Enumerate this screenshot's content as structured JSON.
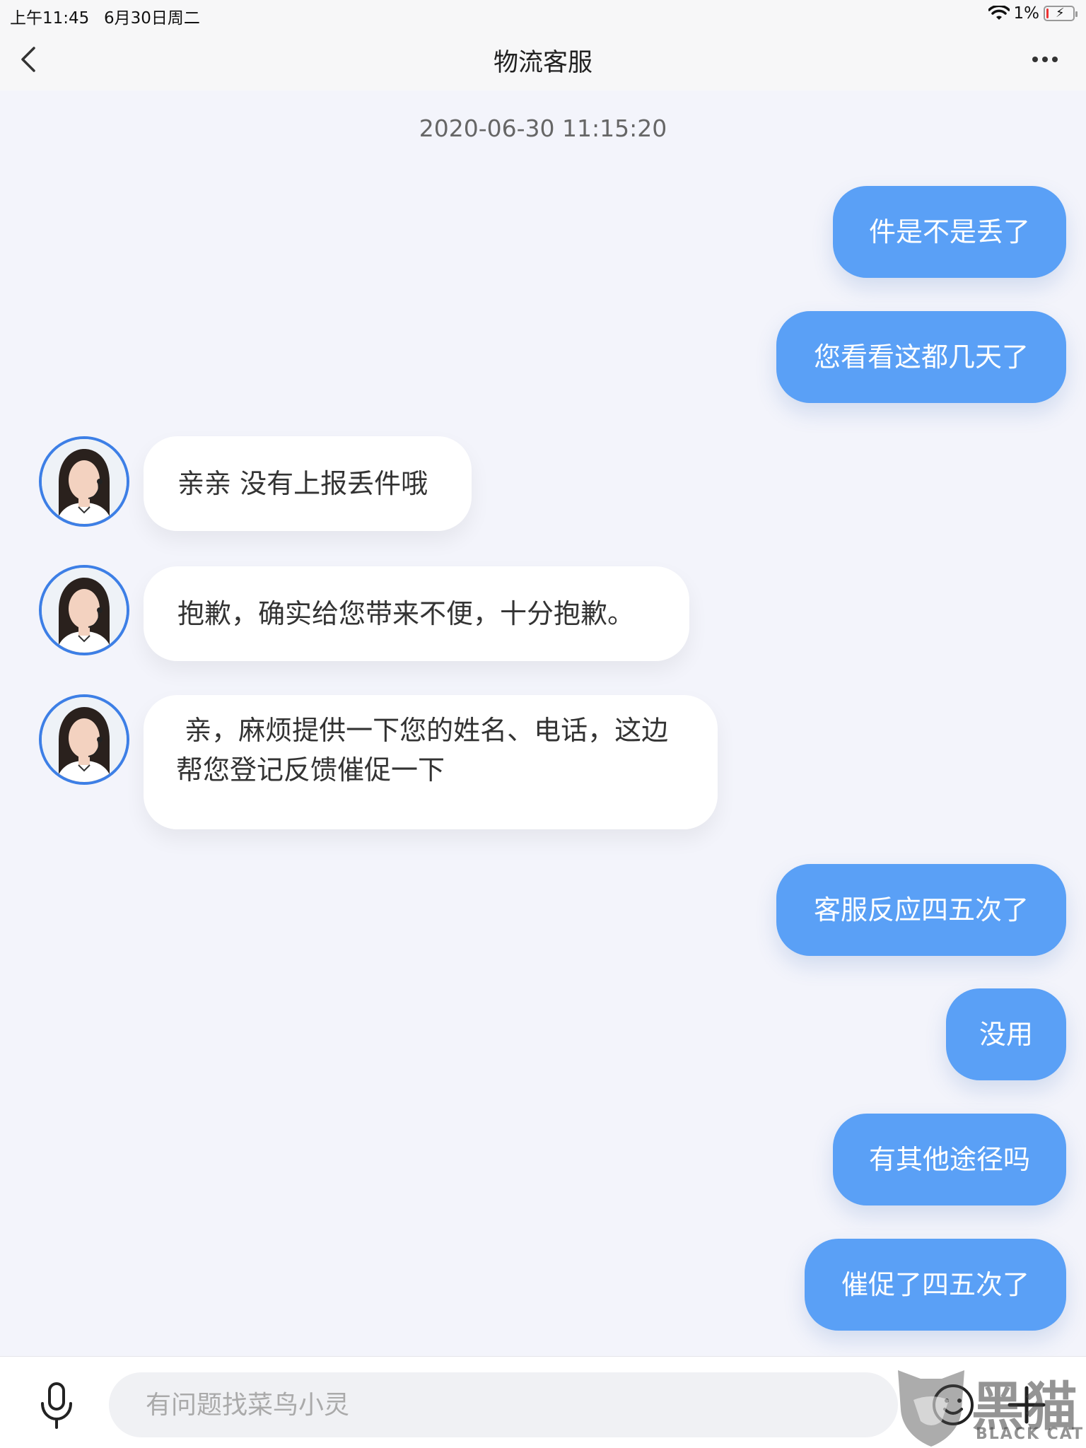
{
  "status_bar": {
    "time": "上午11:45",
    "date": "6月30日周二",
    "battery": "1%"
  },
  "nav": {
    "title": "物流客服"
  },
  "chat": {
    "timestamp": "2020-06-30 11:15:20",
    "messages": [
      {
        "side": "right",
        "text": "件是不是丢了"
      },
      {
        "side": "right",
        "text": "您看看这都几天了"
      },
      {
        "side": "left",
        "text": "亲亲 没有上报丢件哦"
      },
      {
        "side": "left",
        "text": "抱歉，确实给您带来不便，十分抱歉。"
      },
      {
        "side": "left",
        "text": " 亲，麻烦提供一下您的姓名、电话，这边帮您登记反馈催促一下"
      },
      {
        "side": "right",
        "text": "客服反应四五次了"
      },
      {
        "side": "right",
        "text": "没用"
      },
      {
        "side": "right",
        "text": "有其他途径吗"
      },
      {
        "side": "right",
        "text": "催促了四五次了"
      }
    ]
  },
  "input": {
    "placeholder": "有问题找菜鸟小灵"
  },
  "watermark": {
    "cn": "黑猫",
    "en": "BLACK CAT"
  },
  "colors": {
    "accent": "#5aa0f6",
    "avatar_ring": "#3d7fe6",
    "background": "#f3f4fb"
  }
}
